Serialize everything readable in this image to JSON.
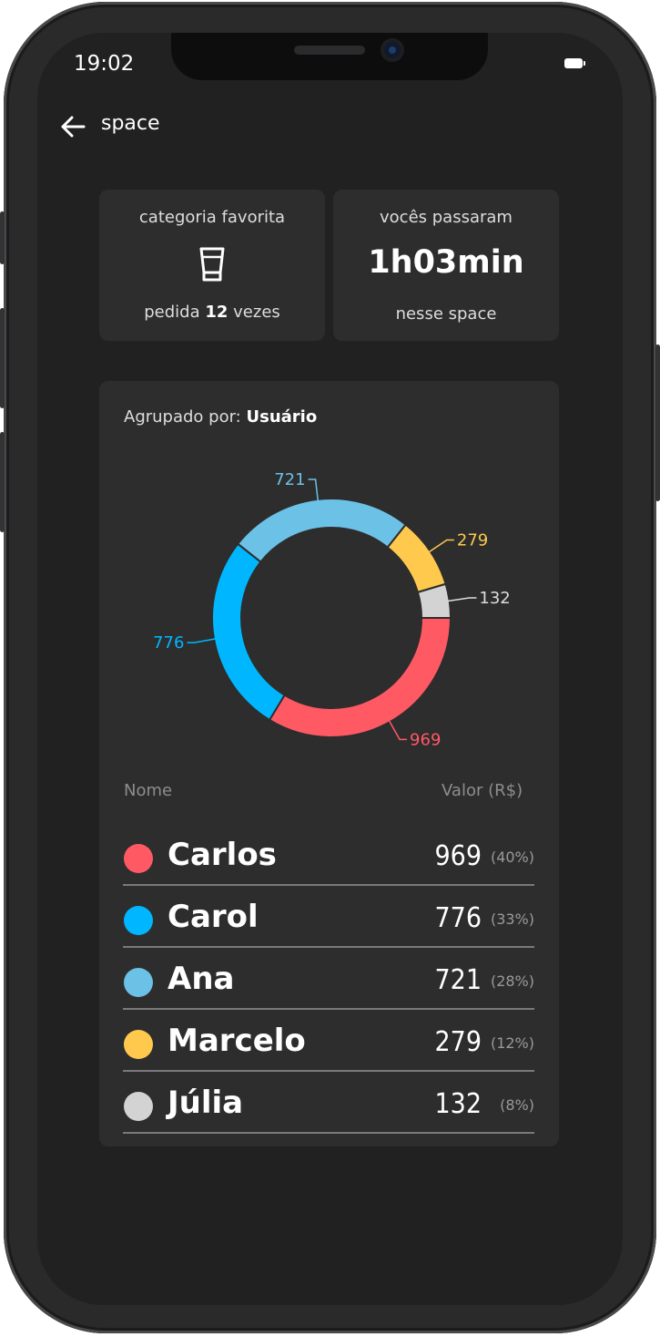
{
  "status_bar": {
    "time": "19:02"
  },
  "header": {
    "title": "space"
  },
  "card_category": {
    "label": "categoria favorita",
    "icon": "glass-icon",
    "count_prefix": "pedida",
    "count": "12",
    "count_suffix": "vezes"
  },
  "card_time": {
    "label": "vocês passaram",
    "value": "1h03min",
    "footer": "nesse space"
  },
  "group": {
    "prefix": "Agrupado por:",
    "value": "Usuário"
  },
  "table": {
    "col_name": "Nome",
    "col_value": "Valor (R$)",
    "rows": [
      {
        "name": "Carlos",
        "value": "969",
        "pct": "(40%)",
        "color": "#ff5964"
      },
      {
        "name": "Carol",
        "value": "776",
        "pct": "(33%)",
        "color": "#00b7ff"
      },
      {
        "name": "Ana",
        "value": "721",
        "pct": "(28%)",
        "color": "#6cc1e6"
      },
      {
        "name": "Marcelo",
        "value": "279",
        "pct": "(12%)",
        "color": "#ffc94d"
      },
      {
        "name": "Júlia",
        "value": "132",
        "pct": "(8%)",
        "color": "#d3d3d3"
      }
    ]
  },
  "chart_data": {
    "type": "pie",
    "categories": [
      "Carlos",
      "Carol",
      "Ana",
      "Marcelo",
      "Júlia"
    ],
    "values": [
      969,
      776,
      721,
      279,
      132
    ],
    "colors": [
      "#ff5964",
      "#00b7ff",
      "#6cc1e6",
      "#ffc94d",
      "#d3d3d3"
    ],
    "donut": true
  }
}
